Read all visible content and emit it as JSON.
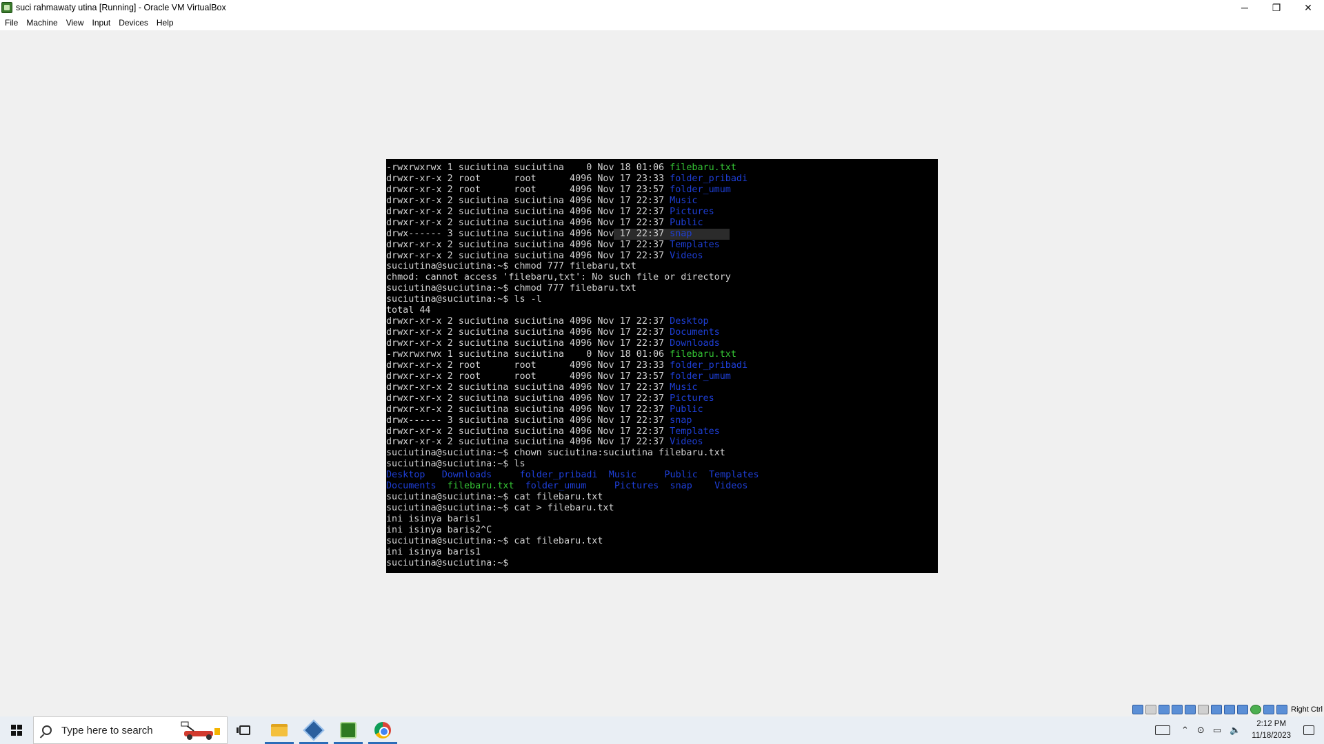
{
  "window": {
    "title": "suci rahmawaty utina [Running] - Oracle VM VirtualBox",
    "minimize": "─",
    "restore": "❐",
    "close": "✕"
  },
  "menu": [
    "File",
    "Machine",
    "View",
    "Input",
    "Devices",
    "Help"
  ],
  "terminal": {
    "lines": [
      {
        "perm": "-rwxrwxrwx 1 suciutina suciutina    0 Nov 18 01:06 ",
        "name": "filebaru.txt",
        "kind": "exec"
      },
      {
        "perm": "drwxr-xr-x 2 root      root      4096 Nov 17 23:33 ",
        "name": "folder_pribadi",
        "kind": "dir"
      },
      {
        "perm": "drwxr-xr-x 2 root      root      4096 Nov 17 23:57 ",
        "name": "folder_umum",
        "kind": "dir"
      },
      {
        "perm": "drwxr-xr-x 2 suciutina suciutina 4096 Nov 17 22:37 ",
        "name": "Music",
        "kind": "dir"
      },
      {
        "perm": "drwxr-xr-x 2 suciutina suciutina 4096 Nov 17 22:37 ",
        "name": "Pictures",
        "kind": "dir"
      },
      {
        "perm": "drwxr-xr-x 2 suciutina suciutina 4096 Nov 17 22:37 ",
        "name": "Public",
        "kind": "dir"
      },
      {
        "perm": "drwx------ 3 suciutina suciutina 4096 Nov 17 22:37 ",
        "name": "snap",
        "kind": "dir",
        "selected": true
      },
      {
        "perm": "drwxr-xr-x 2 suciutina suciutina 4096 Nov 17 22:37 ",
        "name": "Templates",
        "kind": "dir"
      },
      {
        "perm": "drwxr-xr-x 2 suciutina suciutina 4096 Nov 17 22:37 ",
        "name": "Videos",
        "kind": "dir"
      },
      {
        "text": "suciutina@suciutina:~$ chmod 777 filebaru,txt"
      },
      {
        "text": "chmod: cannot access 'filebaru,txt': No such file or directory"
      },
      {
        "text": "suciutina@suciutina:~$ chmod 777 filebaru.txt"
      },
      {
        "text": "suciutina@suciutina:~$ ls -l"
      },
      {
        "text": "total 44"
      },
      {
        "perm": "drwxr-xr-x 2 suciutina suciutina 4096 Nov 17 22:37 ",
        "name": "Desktop",
        "kind": "dir"
      },
      {
        "perm": "drwxr-xr-x 2 suciutina suciutina 4096 Nov 17 22:37 ",
        "name": "Documents",
        "kind": "dir"
      },
      {
        "perm": "drwxr-xr-x 2 suciutina suciutina 4096 Nov 17 22:37 ",
        "name": "Downloads",
        "kind": "dir"
      },
      {
        "perm": "-rwxrwxrwx 1 suciutina suciutina    0 Nov 18 01:06 ",
        "name": "filebaru.txt",
        "kind": "exec"
      },
      {
        "perm": "drwxr-xr-x 2 root      root      4096 Nov 17 23:33 ",
        "name": "folder_pribadi",
        "kind": "dir"
      },
      {
        "perm": "drwxr-xr-x 2 root      root      4096 Nov 17 23:57 ",
        "name": "folder_umum",
        "kind": "dir"
      },
      {
        "perm": "drwxr-xr-x 2 suciutina suciutina 4096 Nov 17 22:37 ",
        "name": "Music",
        "kind": "dir"
      },
      {
        "perm": "drwxr-xr-x 2 suciutina suciutina 4096 Nov 17 22:37 ",
        "name": "Pictures",
        "kind": "dir"
      },
      {
        "perm": "drwxr-xr-x 2 suciutina suciutina 4096 Nov 17 22:37 ",
        "name": "Public",
        "kind": "dir"
      },
      {
        "perm": "drwx------ 3 suciutina suciutina 4096 Nov 17 22:37 ",
        "name": "snap",
        "kind": "dir"
      },
      {
        "perm": "drwxr-xr-x 2 suciutina suciutina 4096 Nov 17 22:37 ",
        "name": "Templates",
        "kind": "dir"
      },
      {
        "perm": "drwxr-xr-x 2 suciutina suciutina 4096 Nov 17 22:37 ",
        "name": "Videos",
        "kind": "dir"
      },
      {
        "text": "suciutina@suciutina:~$ chown suciutina:suciutina filebaru.txt"
      },
      {
        "text": "suciutina@suciutina:~$ ls"
      },
      {
        "ls": [
          {
            "name": "Desktop",
            "kind": "dir",
            "w": 10
          },
          {
            "name": "Downloads",
            "kind": "dir",
            "w": 14
          },
          {
            "name": "folder_pribadi",
            "kind": "dir",
            "w": 16
          },
          {
            "name": "Music",
            "kind": "dir",
            "w": 10
          },
          {
            "name": "Public",
            "kind": "dir",
            "w": 8
          },
          {
            "name": "Templates",
            "kind": "dir",
            "w": 10
          }
        ]
      },
      {
        "ls": [
          {
            "name": "Documents",
            "kind": "dir",
            "w": 11
          },
          {
            "name": "filebaru.txt",
            "kind": "exec",
            "w": 14
          },
          {
            "name": "folder_umum",
            "kind": "dir",
            "w": 16
          },
          {
            "name": "Pictures",
            "kind": "dir",
            "w": 10
          },
          {
            "name": "snap",
            "kind": "dir",
            "w": 8
          },
          {
            "name": "Videos",
            "kind": "dir",
            "w": 10
          }
        ]
      },
      {
        "text": "suciutina@suciutina:~$ cat filebaru.txt"
      },
      {
        "text": "suciutina@suciutina:~$ cat > filebaru.txt"
      },
      {
        "text": "ini isinya baris1"
      },
      {
        "text": "ini isinya baris2^C"
      },
      {
        "text": "suciutina@suciutina:~$ cat filebaru.txt"
      },
      {
        "text": "ini isinya baris1"
      },
      {
        "text": "suciutina@suciutina:~$ "
      }
    ],
    "colors": {
      "dir": "#1e3fd8",
      "exec": "#35c635",
      "text": "#d4d4d4"
    }
  },
  "statusbar": {
    "icons": [
      "hard-disk-icon",
      "optical-drive-icon",
      "audio-icon",
      "network-icon",
      "usb-icon",
      "shared-folder-icon",
      "display-icon",
      "recording-icon",
      "vm-mouse-icon",
      "cpu-icon",
      "integration-icon",
      "keyboard-capture-icon"
    ],
    "host_key": "Right Ctrl"
  },
  "taskbar": {
    "search_placeholder": "Type here to search",
    "time": "2:12 PM",
    "date": "11/18/2023"
  }
}
